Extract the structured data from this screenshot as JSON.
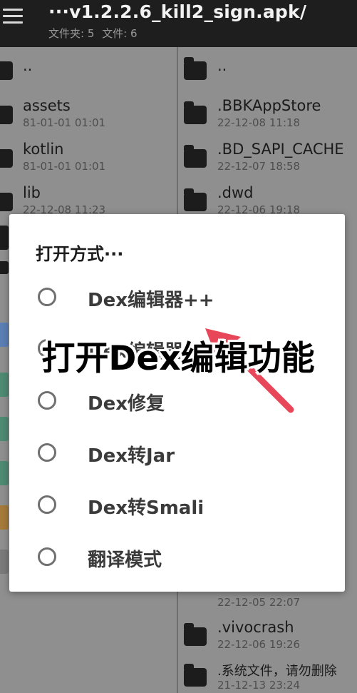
{
  "appbar": {
    "title": "···v1.2.2.6_kill2_sign.apk/",
    "folders_label": "文件夹: 5",
    "files_label": "文件: 6"
  },
  "left_pane": {
    "items": [
      {
        "name": "..",
        "date": ""
      },
      {
        "name": "assets",
        "date": "81-01-01 01:01"
      },
      {
        "name": "kotlin",
        "date": "81-01-01 01:01"
      },
      {
        "name": "lib",
        "date": "22-12-08 11:23"
      }
    ]
  },
  "right_pane": {
    "items_top": [
      {
        "name": "..",
        "date": ""
      },
      {
        "name": ".BBKAppStore",
        "date": "22-12-08 11:18"
      },
      {
        "name": ".BD_SAPI_CACHE",
        "date": "22-12-07 18:58"
      },
      {
        "name": ".dwd",
        "date": "22-12-06 19:18"
      }
    ],
    "items_bottom": [
      {
        "name": "",
        "date": "22-12-05 22:07"
      },
      {
        "name": ".vivocrash",
        "date": "22-12-06 19:26"
      },
      {
        "name": ".系统文件，请勿删除",
        "date": "21-12-13 23:24"
      }
    ]
  },
  "dialog": {
    "title": "打开方式···",
    "options": [
      {
        "label": "Dex编辑器++"
      },
      {
        "label": "Dex编辑器"
      },
      {
        "label": "Dex修复"
      },
      {
        "label": "Dex转Jar"
      },
      {
        "label": "Dex转Smali"
      },
      {
        "label": "翻译模式"
      }
    ]
  },
  "annotation": {
    "caption": "打开Dex编辑功能",
    "arrow_color": "#e8475a"
  },
  "colors": {
    "appbar_bg": "#1e1e1e",
    "dim_bg": "#8f8f8f",
    "dialog_bg": "#ffffff"
  }
}
